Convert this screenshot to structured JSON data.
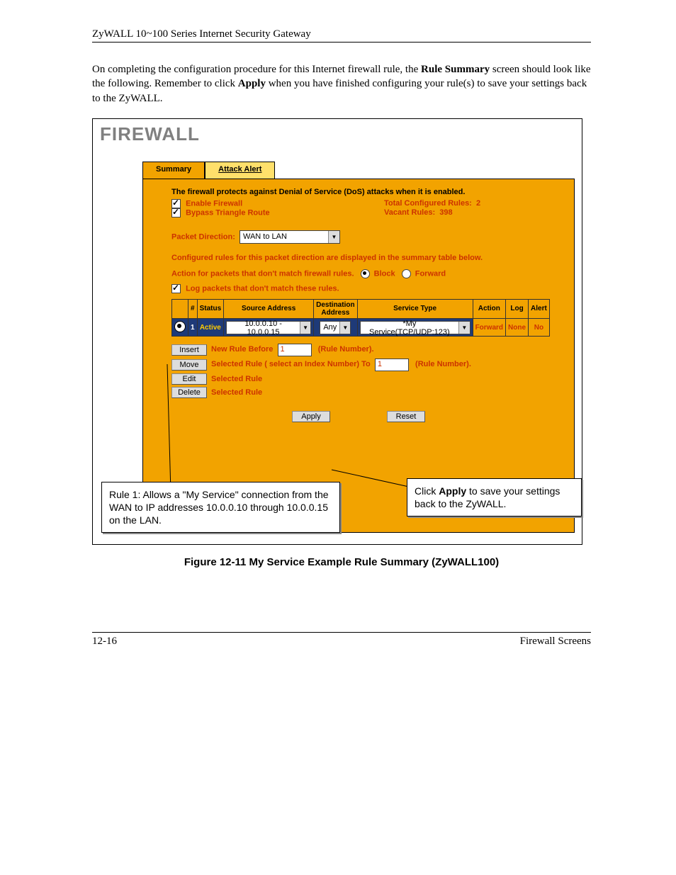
{
  "running_head": "ZyWALL 10~100 Series Internet Security Gateway",
  "lead": {
    "t1": "On completing the configuration procedure for this Internet firewall rule, the ",
    "b1": "Rule Summary",
    "t2": " screen should look like the following. Remember to click ",
    "b2": "Apply",
    "t3": " when you have finished configuring your rule(s) to save your settings back to the ZyWALL."
  },
  "device_title": "FIREWALL",
  "tabs": {
    "summary": "Summary",
    "attack": "Attack Alert"
  },
  "panel": {
    "intro": "The firewall protects against Denial of Service (DoS) attacks when it is enabled.",
    "enable": "Enable Firewall",
    "bypass": "Bypass Triangle Route",
    "total_lbl": "Total Configured Rules:",
    "total_val": "2",
    "vacant_lbl": "Vacant Rules:",
    "vacant_val": "398",
    "pd_lbl": "Packet Direction:",
    "pd_val": "WAN to LAN",
    "rule_dir": "Configured rules for this packet direction are displayed in the summary table below.",
    "action_lbl": "Action for packets that don't match firewall rules.",
    "block": "Block",
    "forward": "Forward",
    "log_cb": "Log packets that don't match these rules."
  },
  "th": {
    "n": "#",
    "status": "Status",
    "src": "Source Address",
    "dst": "Destination Address",
    "svc": "Service Type",
    "action": "Action",
    "log": "Log",
    "alert": "Alert"
  },
  "row": {
    "n": "1",
    "status": "Active",
    "src": "10.0.0.10 - 10.0.0.15",
    "dst": "Any",
    "svc": "*My Service(TCP/UDP:123)",
    "action": "Forward",
    "log": "None",
    "alert": "No"
  },
  "ops": {
    "insert": "Insert",
    "ins_lbl": "New Rule Before",
    "ins_val": "1",
    "ins_sfx": "(Rule Number).",
    "move": "Move",
    "mv_lbl": "Selected Rule ( select an Index Number) To",
    "mv_val": "1",
    "mv_sfx": "(Rule Number).",
    "edit": "Edit",
    "edit_lbl": "Selected Rule",
    "del": "Delete",
    "del_lbl": "Selected Rule"
  },
  "apply": "Apply",
  "reset": "Reset",
  "callout_left": "Rule 1: Allows a \"My Service\" connection from the WAN to IP addresses 10.0.0.10 through 10.0.0.15 on the LAN.",
  "callout_right_a": "Click ",
  "callout_right_b": "Apply",
  "callout_right_c": " to save your settings back to the ZyWALL.",
  "figcap": "Figure 12-11 My Service Example Rule Summary (ZyWALL100)",
  "page_no": "12-16",
  "foot_right": "Firewall Screens"
}
